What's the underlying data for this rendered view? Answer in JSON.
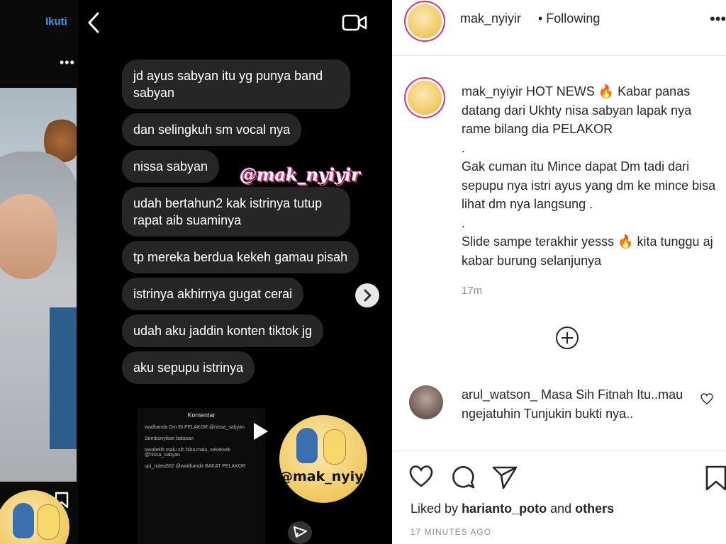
{
  "background_post": {
    "follow_label": "Ikuti",
    "menu_dots": "•••"
  },
  "dm": {
    "messages": [
      "jd ayus sabyan itu yg punya band sabyan",
      "dan selingkuh sm vocal nya",
      "nissa sabyan",
      "udah bertahun2 kak istrinya tutup rapat aib suaminya",
      "tp mereka berdua kekeh gamau pisah",
      "istrinya akhirnya gugat cerai",
      "udah aku jaddin konten tiktok jg",
      "aku sepupu istrinya"
    ],
    "watermark": "@mak_nyiyir",
    "embedded_title": "Komentar",
    "embedded_rows": [
      "wadhanda Dm IN PELAKOR @nissa_sabyan",
      "Sembunyikan balasan",
      "tayobell5 malu sih hiba malu, sekaksek @nissa_sabyan",
      "upi_ndasi502 @wadhanda BAKAT PELAKOR"
    ],
    "logo_text": "@mak_nyiyir"
  },
  "header": {
    "username": "mak_nyiyir",
    "follow_status": "• Following",
    "menu_dots": "•••"
  },
  "caption": {
    "username": "mak_nyiyir",
    "lines": [
      "HOT NEWS 🔥 Kabar panas datang dari Ukhty nisa sabyan lapak nya rame bilang dia PELAKOR",
      ".",
      "Gak cuman itu Mince dapat Dm tadi dari sepupu nya istri ayus yang dm ke mince bisa lihat dm nya langsung .",
      ".",
      "Slide sampe terakhir yesss 🔥 kita tunggu aj kabar burung selanjunya"
    ],
    "time": "17m"
  },
  "comment": {
    "username": "arul_watson_",
    "text": "Masa Sih Fitnah Itu..mau ngejatuhin Tunjukin bukti nya.."
  },
  "likes": {
    "prefix": "Liked by",
    "user": "harianto_poto",
    "connector": "and",
    "others": "others"
  },
  "posted_ago": "17 MINUTES AGO",
  "colors": {
    "link_blue": "#3897f0",
    "bubble": "#262626",
    "story_ring": "#e1306c",
    "muted": "#8e8e8e"
  }
}
